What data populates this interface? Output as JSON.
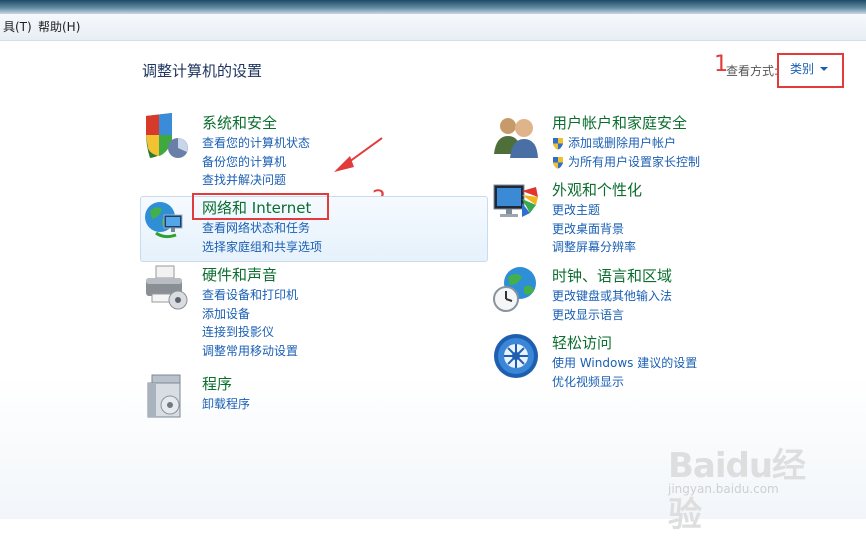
{
  "menu": {
    "tools_fragment": "具(T)",
    "help": "帮助(H)"
  },
  "page_title": "调整计算机的设置",
  "view_by": {
    "label": "查看方式:",
    "value": "类别"
  },
  "annotations": {
    "marker_1": "1",
    "marker_2": "2"
  },
  "categories": {
    "system_security": {
      "title": "系统和安全",
      "links": [
        "查看您的计算机状态",
        "备份您的计算机",
        "查找并解决问题"
      ],
      "icon": "shield-icon"
    },
    "network_internet": {
      "title": "网络和 Internet",
      "links": [
        "查看网络状态和任务",
        "选择家庭组和共享选项"
      ],
      "icon": "network-globe-icon"
    },
    "hardware_sound": {
      "title": "硬件和声音",
      "links": [
        "查看设备和打印机",
        "添加设备",
        "连接到投影仪",
        "调整常用移动设置"
      ],
      "icon": "printer-icon"
    },
    "programs": {
      "title": "程序",
      "links": [
        "卸载程序"
      ],
      "icon": "programs-icon"
    },
    "user_accounts": {
      "title": "用户帐户和家庭安全",
      "links": [
        "添加或删除用户帐户",
        "为所有用户设置家长控制"
      ],
      "icon": "users-icon"
    },
    "appearance": {
      "title": "外观和个性化",
      "links": [
        "更改主题",
        "更改桌面背景",
        "调整屏幕分辨率"
      ],
      "icon": "monitor-colors-icon"
    },
    "clock_language": {
      "title": "时钟、语言和区域",
      "links": [
        "更改键盘或其他输入法",
        "更改显示语言"
      ],
      "icon": "clock-globe-icon"
    },
    "ease_access": {
      "title": "轻松访问",
      "links": [
        "使用 Windows 建议的设置",
        "优化视频显示"
      ],
      "icon": "ease-of-access-icon"
    }
  },
  "watermark": {
    "brand": "Baidu经验",
    "url": "jingyan.baidu.com"
  },
  "colors": {
    "link": "#1a5fb4",
    "category_title": "#0b6e2f",
    "annotation_red": "#e23b3b"
  }
}
